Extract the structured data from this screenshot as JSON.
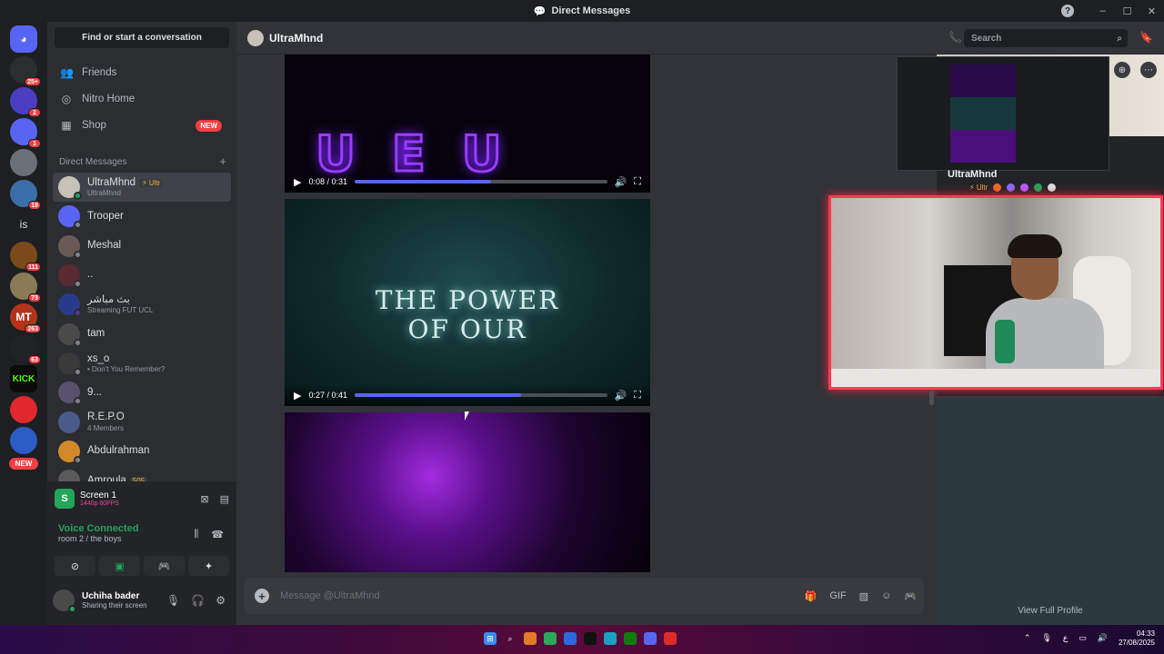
{
  "window": {
    "title": "Direct Messages",
    "help": "?",
    "controls": [
      "–",
      "☐",
      "✕"
    ]
  },
  "servers": [
    {
      "label": "",
      "badge": "",
      "kind": "home"
    },
    {
      "label": "",
      "badge": "25+",
      "color": "#2b2d31"
    },
    {
      "label": "",
      "badge": "2",
      "color": "#4a3fc2"
    },
    {
      "label": "",
      "badge": "1",
      "color": "#5865f2"
    },
    {
      "label": "",
      "badge": "",
      "color": "#6a6f78"
    },
    {
      "label": "",
      "badge": "19",
      "color": "#3b6fa8"
    },
    {
      "label": "is",
      "badge": "",
      "kind": "text"
    },
    {
      "label": "",
      "badge": "111",
      "color": "#7a4a1a"
    },
    {
      "label": "",
      "badge": "73",
      "color": "#8a7a55"
    },
    {
      "label": "MT",
      "badge": "263",
      "color": "#b3341a"
    },
    {
      "label": "",
      "badge": "63",
      "color": "#202225"
    },
    {
      "label": "KICK",
      "badge": "",
      "kind": "kick"
    },
    {
      "label": "",
      "badge": "",
      "color": "#e0282e"
    },
    {
      "label": "",
      "badge": "",
      "color": "#2c5cc5"
    }
  ],
  "servers_new": "NEW",
  "sidebar": {
    "search_label": "Find or start a conversation",
    "nav": [
      {
        "label": "Friends",
        "icon": "friends-icon",
        "glyph": "👥"
      },
      {
        "label": "Nitro Home",
        "icon": "nitro-icon",
        "glyph": "◎"
      },
      {
        "label": "Shop",
        "icon": "shop-icon",
        "glyph": "▦",
        "tag": "NEW"
      }
    ],
    "dm_header": "Direct Messages",
    "dm_add": "+",
    "dms": [
      {
        "name": "UltraMhnd",
        "tag": "⚡ Ultr",
        "sub": "UltraMhnd",
        "color": "#c7c1b7",
        "status": "#23a55a",
        "active": true
      },
      {
        "name": "Trooper",
        "sub": "",
        "color": "#5865f2",
        "status": "#80848e"
      },
      {
        "name": "Meshal",
        "sub": "",
        "color": "#6a5a55",
        "status": "#80848e"
      },
      {
        "name": "..",
        "sub": "",
        "color": "#5a2a30",
        "status": "#80848e"
      },
      {
        "name": "بث مباشر",
        "sub": "Streaming FUT UCL",
        "color": "#2a3a8a",
        "status": "#593695"
      },
      {
        "name": "tam",
        "sub": "",
        "color": "#4a4a4a",
        "status": "#80848e"
      },
      {
        "name": "xs_o",
        "sub": "• Don't You Remember?",
        "color": "#3a3a3a",
        "status": "#80848e"
      },
      {
        "name": "9...",
        "sub": "",
        "color": "#5a5070",
        "status": "#80848e"
      },
      {
        "name": "R.E.P.O",
        "sub": "4 Members",
        "color": "#4a5a8a",
        "status": ""
      },
      {
        "name": "Abdulrahman",
        "sub": "",
        "color": "#d08a2a",
        "status": "#80848e"
      },
      {
        "name": "Amroula",
        "tag": "505",
        "sub": "",
        "color": "#5a5a5a",
        "status": "#80848e"
      }
    ]
  },
  "userbar": {
    "screen_title": "Screen 1",
    "screen_sub": "1440p 60FPS",
    "voice_title": "Voice Connected",
    "voice_room": "room 2 / the boys",
    "user_name": "Uchiha bader",
    "user_sub": "Sharing their screen"
  },
  "chat": {
    "recipient": "UltraMhnd",
    "search_placeholder": "Search",
    "videos": [
      {
        "time": "0:08 / 0:31",
        "progress": 0.54
      },
      {
        "time": "0:27 / 0:41",
        "progress": 0.66,
        "line1": "THE POWER",
        "line2": "OF OUR"
      },
      {
        "time": "",
        "progress": 0
      }
    ],
    "input_placeholder": "Message @UltraMhnd"
  },
  "profile": {
    "name": "UltraMhnd",
    "badge_tag": "⚡ Ultr",
    "view_full": "View Full Profile"
  },
  "taskbar": {
    "time": "04:33",
    "date": "27/08/2025",
    "lang": "ع"
  },
  "colors": {
    "accent": "#5865f2",
    "online": "#23a55a",
    "danger": "#f23f43",
    "webcam_border": "#ff3a55"
  }
}
